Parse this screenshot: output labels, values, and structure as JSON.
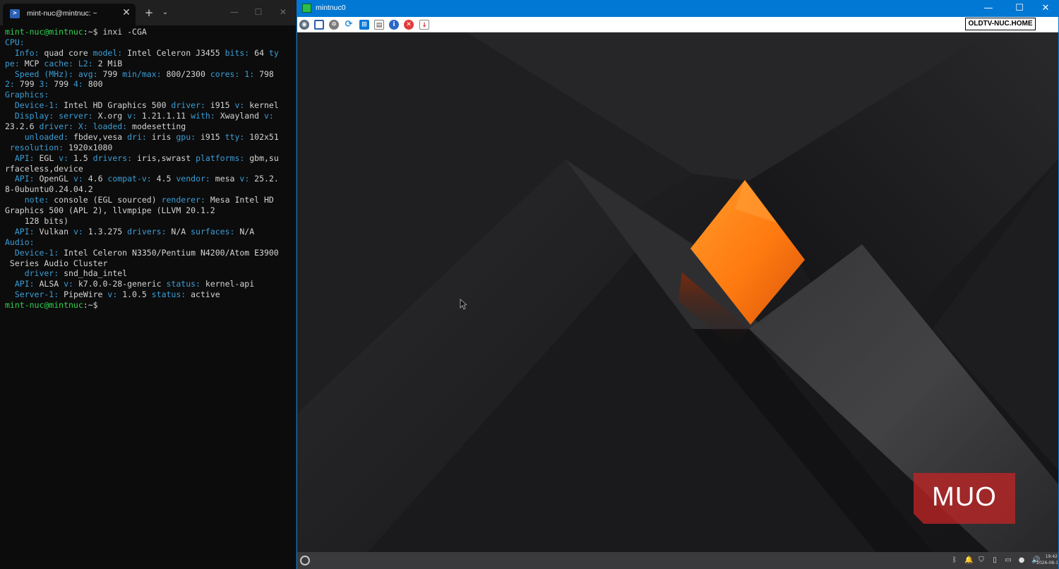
{
  "terminal": {
    "tab_title": "mint-nuc@mintnuc: ~",
    "tab_icon": "powershell-icon",
    "new_tab_glyph": "+",
    "tab_menu_glyph": "⌄",
    "close_tab_glyph": "✕",
    "window_controls": {
      "minimize": "—",
      "maximize": "☐",
      "close": "✕"
    },
    "colors": {
      "background": "#0c0c0c",
      "prompt": "#2fd34f",
      "key": "#3b9dd6",
      "text": "#d4d4d4"
    },
    "lines": [
      [
        [
          "g",
          "mint-nuc@mintnuc"
        ],
        [
          "w",
          ":~$ inxi -CGA"
        ]
      ],
      [
        [
          "b",
          "CPU:"
        ]
      ],
      [
        [
          "b",
          "  Info: "
        ],
        [
          "w",
          "quad core "
        ],
        [
          "b",
          "model: "
        ],
        [
          "w",
          "Intel Celeron J3455 "
        ],
        [
          "b",
          "bits: "
        ],
        [
          "w",
          "64 "
        ],
        [
          "b",
          "ty"
        ]
      ],
      [
        [
          "b",
          "pe: "
        ],
        [
          "w",
          "MCP "
        ],
        [
          "b",
          "cache: L2: "
        ],
        [
          "w",
          "2 MiB"
        ]
      ],
      [
        [
          "b",
          "  Speed (MHz): avg: "
        ],
        [
          "w",
          "799 "
        ],
        [
          "b",
          "min/max: "
        ],
        [
          "w",
          "800/2300 "
        ],
        [
          "b",
          "cores: 1: "
        ],
        [
          "w",
          "798"
        ]
      ],
      [
        [
          "b",
          "2: "
        ],
        [
          "w",
          "799 "
        ],
        [
          "b",
          "3: "
        ],
        [
          "w",
          "799 "
        ],
        [
          "b",
          "4: "
        ],
        [
          "w",
          "800"
        ]
      ],
      [
        [
          "b",
          "Graphics:"
        ]
      ],
      [
        [
          "b",
          "  Device-1: "
        ],
        [
          "w",
          "Intel HD Graphics 500 "
        ],
        [
          "b",
          "driver: "
        ],
        [
          "w",
          "i915 "
        ],
        [
          "b",
          "v: "
        ],
        [
          "w",
          "kernel"
        ]
      ],
      [
        [
          "b",
          "  Display: server: "
        ],
        [
          "w",
          "X.org "
        ],
        [
          "b",
          "v: "
        ],
        [
          "w",
          "1.21.1.11 "
        ],
        [
          "b",
          "with: "
        ],
        [
          "w",
          "Xwayland "
        ],
        [
          "b",
          "v:"
        ]
      ],
      [
        [
          "w",
          "23.2.6 "
        ],
        [
          "b",
          "driver: X: loaded: "
        ],
        [
          "w",
          "modesetting"
        ]
      ],
      [
        [
          "b",
          "    unloaded: "
        ],
        [
          "w",
          "fbdev,vesa "
        ],
        [
          "b",
          "dri: "
        ],
        [
          "w",
          "iris "
        ],
        [
          "b",
          "gpu: "
        ],
        [
          "w",
          "i915 "
        ],
        [
          "b",
          "tty: "
        ],
        [
          "w",
          "102x51"
        ]
      ],
      [
        [
          "b",
          " resolution: "
        ],
        [
          "w",
          "1920x1080"
        ]
      ],
      [
        [
          "b",
          "  API: "
        ],
        [
          "w",
          "EGL "
        ],
        [
          "b",
          "v: "
        ],
        [
          "w",
          "1.5 "
        ],
        [
          "b",
          "drivers: "
        ],
        [
          "w",
          "iris,swrast "
        ],
        [
          "b",
          "platforms: "
        ],
        [
          "w",
          "gbm,su"
        ]
      ],
      [
        [
          "w",
          "rfaceless,device"
        ]
      ],
      [
        [
          "b",
          "  API: "
        ],
        [
          "w",
          "OpenGL "
        ],
        [
          "b",
          "v: "
        ],
        [
          "w",
          "4.6 "
        ],
        [
          "b",
          "compat-v: "
        ],
        [
          "w",
          "4.5 "
        ],
        [
          "b",
          "vendor: "
        ],
        [
          "w",
          "mesa "
        ],
        [
          "b",
          "v: "
        ],
        [
          "w",
          "25.2."
        ]
      ],
      [
        [
          "w",
          "8-0ubuntu0.24.04.2"
        ]
      ],
      [
        [
          "b",
          "    note: "
        ],
        [
          "w",
          "console (EGL sourced) "
        ],
        [
          "b",
          "renderer: "
        ],
        [
          "w",
          "Mesa Intel HD"
        ]
      ],
      [
        [
          "w",
          "Graphics 500 (APL 2), llvmpipe (LLVM 20.1.2"
        ]
      ],
      [
        [
          "w",
          "    128 bits)"
        ]
      ],
      [
        [
          "b",
          "  API: "
        ],
        [
          "w",
          "Vulkan "
        ],
        [
          "b",
          "v: "
        ],
        [
          "w",
          "1.3.275 "
        ],
        [
          "b",
          "drivers: "
        ],
        [
          "w",
          "N/A "
        ],
        [
          "b",
          "surfaces: "
        ],
        [
          "w",
          "N/A"
        ]
      ],
      [
        [
          "b",
          "Audio:"
        ]
      ],
      [
        [
          "b",
          "  Device-1: "
        ],
        [
          "w",
          "Intel Celeron N3350/Pentium N4200/Atom E3900"
        ]
      ],
      [
        [
          "w",
          " Series Audio Cluster"
        ]
      ],
      [
        [
          "b",
          "    driver: "
        ],
        [
          "w",
          "snd_hda_intel"
        ]
      ],
      [
        [
          "b",
          "  API: "
        ],
        [
          "w",
          "ALSA "
        ],
        [
          "b",
          "v: "
        ],
        [
          "w",
          "k7.0.0-28-generic "
        ],
        [
          "b",
          "status: "
        ],
        [
          "w",
          "kernel-api"
        ]
      ],
      [
        [
          "b",
          "  Server-1: "
        ],
        [
          "w",
          "PipeWire "
        ],
        [
          "b",
          "v: "
        ],
        [
          "w",
          "1.0.5 "
        ],
        [
          "b",
          "status: "
        ],
        [
          "w",
          "active"
        ]
      ],
      [
        [
          "g",
          "mint-nuc@mintnuc"
        ],
        [
          "w",
          ":~$"
        ]
      ]
    ]
  },
  "vm_viewer": {
    "title": "mintnuc0",
    "title_bar_color": "#0078d4",
    "hostname": "OLDTV-NUC.HOME",
    "window_controls": {
      "minimize": "—",
      "maximize": "☐",
      "close": "✕"
    },
    "toolbar": [
      {
        "name": "display-settings-icon",
        "glyph": "◉"
      },
      {
        "name": "fullscreen-icon",
        "glyph": ""
      },
      {
        "name": "settings-gear-icon",
        "glyph": "✲"
      },
      {
        "name": "refresh-icon",
        "glyph": "⟳"
      },
      {
        "name": "windows-key-icon",
        "glyph": "⊞"
      },
      {
        "name": "clipboard-icon",
        "glyph": "▤"
      },
      {
        "name": "info-icon",
        "glyph": "i"
      },
      {
        "name": "disconnect-icon",
        "glyph": "✕"
      },
      {
        "name": "file-transfer-icon",
        "glyph": "↓"
      }
    ]
  },
  "guest_desktop": {
    "wallpaper_accent": "#ff8a1a",
    "watermark_text": "MUO",
    "taskbar": {
      "tray_icons": [
        {
          "name": "bluetooth-icon",
          "glyph": "ᛒ"
        },
        {
          "name": "notification-bell-icon",
          "glyph": "🔔"
        },
        {
          "name": "shield-icon",
          "glyph": "⛉"
        },
        {
          "name": "clipboard-tray-icon",
          "glyph": "▯"
        },
        {
          "name": "battery-icon",
          "glyph": "▭"
        },
        {
          "name": "update-drop-icon",
          "glyph": "●"
        },
        {
          "name": "volume-icon",
          "glyph": "🔊"
        }
      ],
      "clock_time": "19:42",
      "clock_date": "2026-08-10"
    }
  }
}
